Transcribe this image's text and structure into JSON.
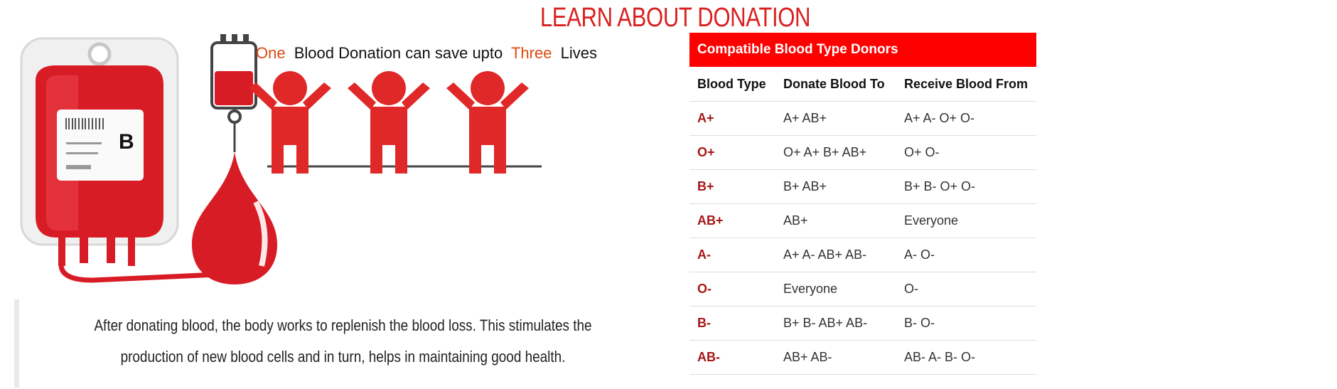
{
  "page_title": "LEARN ABOUT DONATION",
  "illustration": {
    "tagline_word1": "One",
    "tagline_mid": "Blood Donation can save upto",
    "tagline_word2": "Three",
    "tagline_end": "Lives",
    "bag_label": "B",
    "accent_color": "#e02828",
    "highlight_color": "#e04a10"
  },
  "caption": "After donating blood, the body works to replenish the blood loss. This stimulates the production of new blood cells and in turn, helps in maintaining good health.",
  "table": {
    "header": "Compatible Blood Type Donors",
    "columns": [
      "Blood Type",
      "Donate Blood To",
      "Receive Blood From"
    ],
    "rows": [
      [
        "A+",
        "A+ AB+",
        "A+ A- O+ O-"
      ],
      [
        "O+",
        "O+ A+ B+ AB+",
        "O+ O-"
      ],
      [
        "B+",
        "B+ AB+",
        "B+ B- O+ O-"
      ],
      [
        "AB+",
        "AB+",
        "Everyone"
      ],
      [
        "A-",
        "A+ A- AB+ AB-",
        "A- O-"
      ],
      [
        "O-",
        "Everyone",
        "O-"
      ],
      [
        "B-",
        "B+ B- AB+ AB-",
        "B- O-"
      ],
      [
        "AB-",
        "AB+ AB-",
        "AB- A- B- O-"
      ]
    ]
  }
}
